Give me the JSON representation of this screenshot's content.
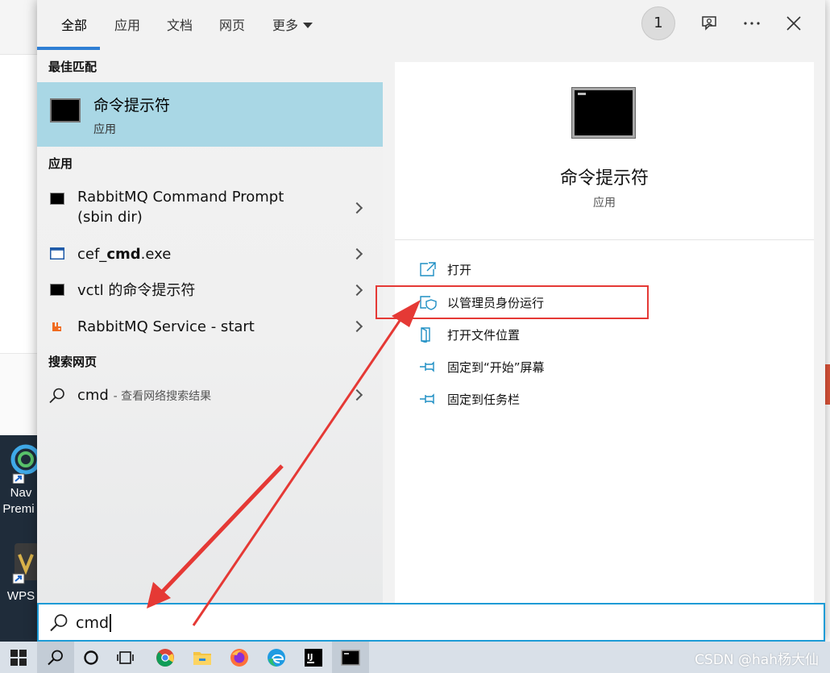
{
  "tabs": [
    {
      "label": "全部"
    },
    {
      "label": "应用"
    },
    {
      "label": "文档"
    },
    {
      "label": "网页"
    },
    {
      "label": "更多"
    }
  ],
  "header": {
    "badge_count": "1"
  },
  "best_match": {
    "heading": "最佳匹配",
    "title": "命令提示符",
    "subtitle": "应用"
  },
  "apps": {
    "heading": "应用",
    "items": [
      {
        "label_line1": "RabbitMQ Command Prompt",
        "label_line2": "(sbin dir)",
        "icon": "console-icon"
      },
      {
        "label_prefix": "cef_",
        "label_bold": "cmd",
        "label_suffix": ".exe",
        "icon": "window-icon"
      },
      {
        "label": "vctl 的命令提示符",
        "icon": "console-icon"
      },
      {
        "label": "RabbitMQ Service - start",
        "icon": "rabbitmq-icon"
      }
    ]
  },
  "web": {
    "heading": "搜索网页",
    "query": "cmd",
    "hint": "- 查看网络搜索结果"
  },
  "preview": {
    "title": "命令提示符",
    "subtitle": "应用",
    "actions": [
      {
        "label": "打开",
        "icon": "open-icon"
      },
      {
        "label": "以管理员身份运行",
        "icon": "shield-icon"
      },
      {
        "label": "打开文件位置",
        "icon": "folder-icon"
      },
      {
        "label": "固定到“开始”屏幕",
        "icon": "pin-icon"
      },
      {
        "label": "固定到任务栏",
        "icon": "pin-icon"
      }
    ]
  },
  "search": {
    "value": "cmd"
  },
  "desktop": {
    "icons": [
      {
        "label_line1": "Nav",
        "label_line2": "Premi"
      },
      {
        "label_line1": "WPS",
        "label_line2": ""
      }
    ]
  },
  "taskbar": {
    "icons": [
      "windows-start-icon",
      "search-icon",
      "cortana-icon",
      "task-view-icon",
      "chrome-icon",
      "file-explorer-icon",
      "firefox-icon",
      "edge-icon",
      "intellij-icon",
      "terminal-icon"
    ]
  },
  "watermark": "CSDN @hah杨大仙",
  "colors": {
    "accent": "#2f7fd4",
    "highlight": "#a9d7e5",
    "annotation": "#e53935",
    "search_border": "#1d9bd6"
  }
}
